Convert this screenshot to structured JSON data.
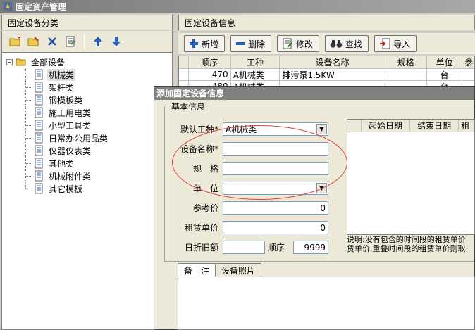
{
  "window": {
    "title": "固定资产管理"
  },
  "left_panel": {
    "header": "固定设备分类",
    "tree": {
      "root": "全部设备",
      "items": [
        "机械类",
        "架杆类",
        "钢模板类",
        "施工用电类",
        "小型工具类",
        "日常办公用品类",
        "仪器仪表类",
        "其他类",
        "机械附件类",
        "其它模板"
      ]
    }
  },
  "right_panel": {
    "header": "固定设备信息",
    "toolbar": {
      "add": "新增",
      "delete": "删除",
      "edit": "修改",
      "search": "查找",
      "import": "导入"
    },
    "table": {
      "columns": [
        "顺序",
        "工种",
        "设备名称",
        "规格",
        "单位",
        "参"
      ],
      "rows": [
        [
          "470",
          "A机械类",
          "排污泵1.5KW",
          "",
          "台"
        ],
        [
          "480",
          "A机械类",
          "",
          "",
          "台"
        ]
      ]
    }
  },
  "dialog": {
    "title": "添加固定设备信息",
    "group_title": "基本信息",
    "fields": {
      "work_type_label": "默认工种*",
      "work_type_value": "A机械类",
      "name_label": "设备名称*",
      "name_value": "",
      "spec_label": "规　格",
      "spec_value": "",
      "unit_label": "单　位",
      "unit_value": "",
      "ref_price_label": "参考价",
      "ref_price_value": "0",
      "rent_price_label": "租赁单价",
      "rent_price_value": "0",
      "depr_label": "日折旧额",
      "depr_value": "",
      "order_label": "顺序",
      "order_value": "9999"
    },
    "date_grid": {
      "columns": [
        "起始日期",
        "结束日期",
        "租"
      ]
    },
    "note": [
      "说明:没有包含的时间段的租赁单价",
      "赁单价,重叠时间段的租赁单价则取"
    ],
    "tabs": [
      "备　注",
      "设备照片"
    ]
  }
}
